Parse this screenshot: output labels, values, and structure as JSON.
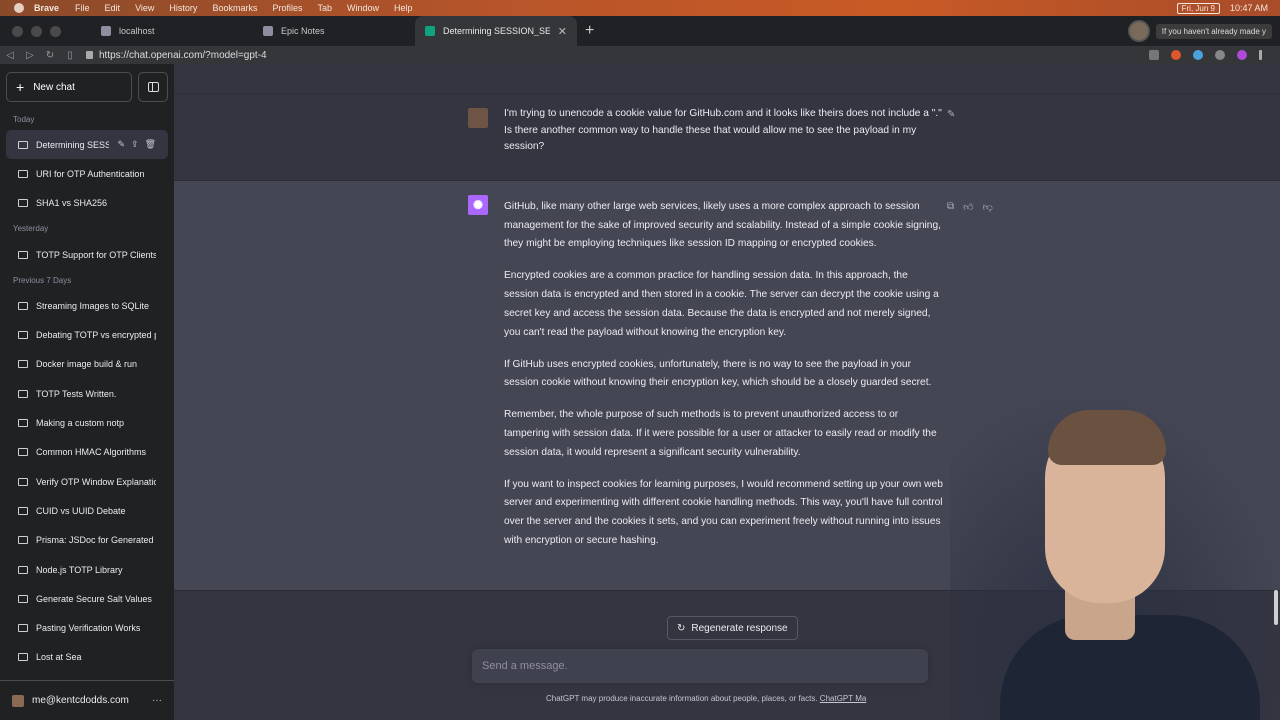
{
  "menubar": {
    "app": "Brave",
    "items": [
      "File",
      "Edit",
      "View",
      "History",
      "Bookmarks",
      "Profiles",
      "Tab",
      "Window",
      "Help"
    ],
    "date": "Fri, Jun 9",
    "time": "10:47 AM"
  },
  "browser": {
    "tabs": [
      {
        "title": "localhost"
      },
      {
        "title": "Epic Notes"
      },
      {
        "title": "Determining SESSION_SECRET"
      }
    ],
    "notice": "If you haven't already made y",
    "url": "https://chat.openai.com/?model=gpt-4"
  },
  "sidebar": {
    "new_chat": "New chat",
    "groups": [
      {
        "label": "Today",
        "items": [
          "Determining SESSIO",
          "URI for OTP Authentication",
          "SHA1 vs SHA256"
        ]
      },
      {
        "label": "Yesterday",
        "items": [
          "TOTP Support for OTP Clients"
        ]
      },
      {
        "label": "Previous 7 Days",
        "items": [
          "Streaming Images to SQLite",
          "Debating TOTP vs encrypted p",
          "Docker image build & run",
          "TOTP Tests Written.",
          "Making a custom notp",
          "Common HMAC Algorithms",
          "Verify OTP Window Explanatio",
          "CUID vs UUID Debate",
          "Prisma: JSDoc for Generated C",
          "Node.js TOTP Library",
          "Generate Secure Salt Values",
          "Pasting Verification Works",
          "Lost at Sea"
        ]
      }
    ],
    "user_email": "me@kentcdodds.com"
  },
  "conversation": {
    "user_message": "I'm trying to unencode a cookie value for GitHub.com and it looks like theirs does not include a \".\" Is there another common way to handle these that would allow me to see the payload in my session?",
    "assistant_paragraphs": [
      "GitHub, like many other large web services, likely uses a more complex approach to session management for the sake of improved security and scalability. Instead of a simple cookie signing, they might be employing techniques like session ID mapping or encrypted cookies.",
      "Encrypted cookies are a common practice for handling session data. In this approach, the session data is encrypted and then stored in a cookie. The server can decrypt the cookie using a secret key and access the session data. Because the data is encrypted and not merely signed, you can't read the payload without knowing the encryption key.",
      "If GitHub uses encrypted cookies, unfortunately, there is no way to see the payload in your session cookie without knowing their encryption key, which should be a closely guarded secret.",
      "Remember, the whole purpose of such methods is to prevent unauthorized access to or tampering with session data. If it were possible for a user or attacker to easily read or modify the session data, it would represent a significant security vulnerability.",
      "If you want to inspect cookies for learning purposes, I would recommend setting up your own web server and experimenting with different cookie handling methods. This way, you'll have full control over the server and the cookies it sets, and you can experiment freely without running into issues with encryption or secure hashing."
    ]
  },
  "composer": {
    "regenerate": "Regenerate response",
    "placeholder": "Send a message.",
    "disclaimer": "ChatGPT may produce inaccurate information about people, places, or facts.",
    "disclaimer_link": "ChatGPT Ma"
  },
  "colors": {
    "sidebar_bg": "#202123",
    "main_bg": "#343541",
    "assistant_bg": "#444654",
    "gpt_avatar": "#ab68ff"
  }
}
